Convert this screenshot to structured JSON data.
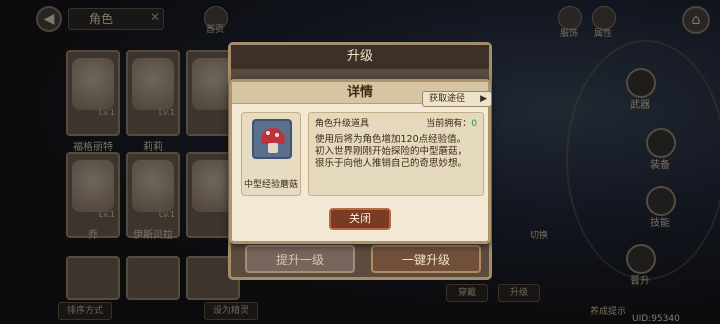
{
  "header": {
    "title": "角色",
    "back_icon": "back-arrow-icon",
    "close_icon": "close-icon"
  },
  "top_icons": [
    {
      "name": "home-small-icon",
      "label": "首页"
    },
    {
      "name": "costume-icon",
      "label": "服饰"
    },
    {
      "name": "attribute-icon",
      "label": "属性"
    }
  ],
  "characters": [
    {
      "name": "福格丽特",
      "level": "Lv.1"
    },
    {
      "name": "莉莉",
      "level": "Lv.1"
    },
    {
      "name": "乔",
      "level": "Lv.1"
    },
    {
      "name": "伊斯贝拉",
      "level": "Lv.1"
    }
  ],
  "side_menu": [
    {
      "label": "武器"
    },
    {
      "label": "装备"
    },
    {
      "label": "技能"
    },
    {
      "label": "晋升"
    }
  ],
  "bottom": {
    "sort_label": "排序方式",
    "favorite_label": "设为精灵",
    "switch_label": "切换",
    "cultivate_label": "养成提示",
    "wear_label": "穿戴",
    "upgrade_label": "升级",
    "uid": "UID:95340"
  },
  "upgrade_panel": {
    "title": "升级",
    "upgrade_one_label": "提升一级",
    "upgrade_all_label": "一键升级"
  },
  "detail_dialog": {
    "title": "详情",
    "source_label": "获取途径",
    "item_name": "中型经验蘑菇",
    "item_type": "角色升级道具",
    "owned_label": "当前拥有：",
    "owned_count": "0",
    "description_lines": [
      "使用后将为角色增加120点经验值。",
      "初入世界刚刚开始探险的中型蘑菇，",
      "很乐于向他人推销自己的奇思妙想。"
    ],
    "close_label": "关闭"
  }
}
